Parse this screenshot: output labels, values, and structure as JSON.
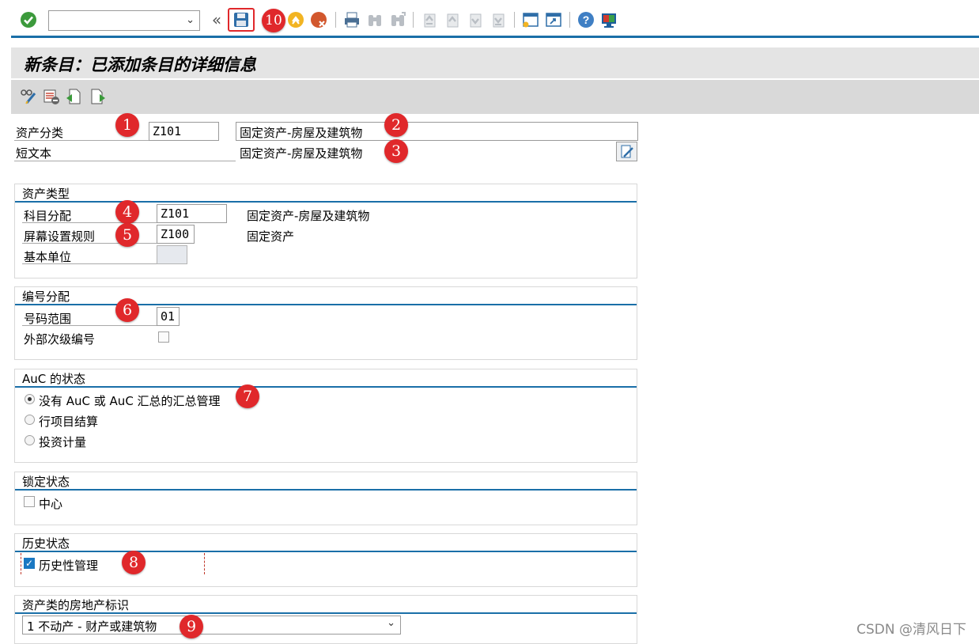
{
  "toolbar": {
    "command_field_value": "",
    "icons": [
      "check-icon",
      "save-icon",
      "back-icon",
      "exit-icon",
      "cancel-icon",
      "print-icon",
      "find-icon",
      "find-next-icon",
      "first-page-icon",
      "prev-page-icon",
      "next-page-icon",
      "last-page-icon",
      "new-session-icon",
      "shortcut-icon",
      "help-icon",
      "customize-layout-icon"
    ]
  },
  "title": "新条目：已添加条目的详细信息",
  "header": {
    "asset_class_label": "资产分类",
    "asset_class_value": "Z101",
    "asset_class_desc": "固定资产-房屋及建筑物",
    "short_text_label": "短文本",
    "short_text_value": "固定资产-房屋及建筑物"
  },
  "groups": {
    "asset_type": {
      "title": "资产类型",
      "account_det_label": "科目分配",
      "account_det_value": "Z101",
      "account_det_desc": "固定资产-房屋及建筑物",
      "screen_layout_label": "屏幕设置规则",
      "screen_layout_value": "Z100",
      "screen_layout_desc": "固定资产",
      "base_unit_label": "基本单位",
      "base_unit_value": ""
    },
    "numbering": {
      "title": "编号分配",
      "number_range_label": "号码范围",
      "number_range_value": "01",
      "external_sub_label": "外部次级编号"
    },
    "auc_status": {
      "title": "AuC 的状态",
      "options": [
        "没有 AuC 或 AuC 汇总的汇总管理",
        "行项目结算",
        "投资计量"
      ],
      "selected_index": 0
    },
    "lock_status": {
      "title": "锁定状态",
      "center_label": "中心"
    },
    "history_status": {
      "title": "历史状态",
      "history_mgmt_label": "历史性管理",
      "history_mgmt_checked": true
    },
    "real_estate": {
      "title": "资产类的房地产标识",
      "selected_value": "1 不动产 - 财产或建筑物"
    }
  },
  "badges": [
    "1",
    "2",
    "3",
    "4",
    "5",
    "6",
    "7",
    "8",
    "9",
    "10"
  ],
  "watermark": "CSDN @清风日下",
  "colors": {
    "accent_line": "#1a6fa8",
    "badge": "#e0282b",
    "title_bar": "#e4e4e4",
    "app_toolbar": "#d9d9d9"
  }
}
